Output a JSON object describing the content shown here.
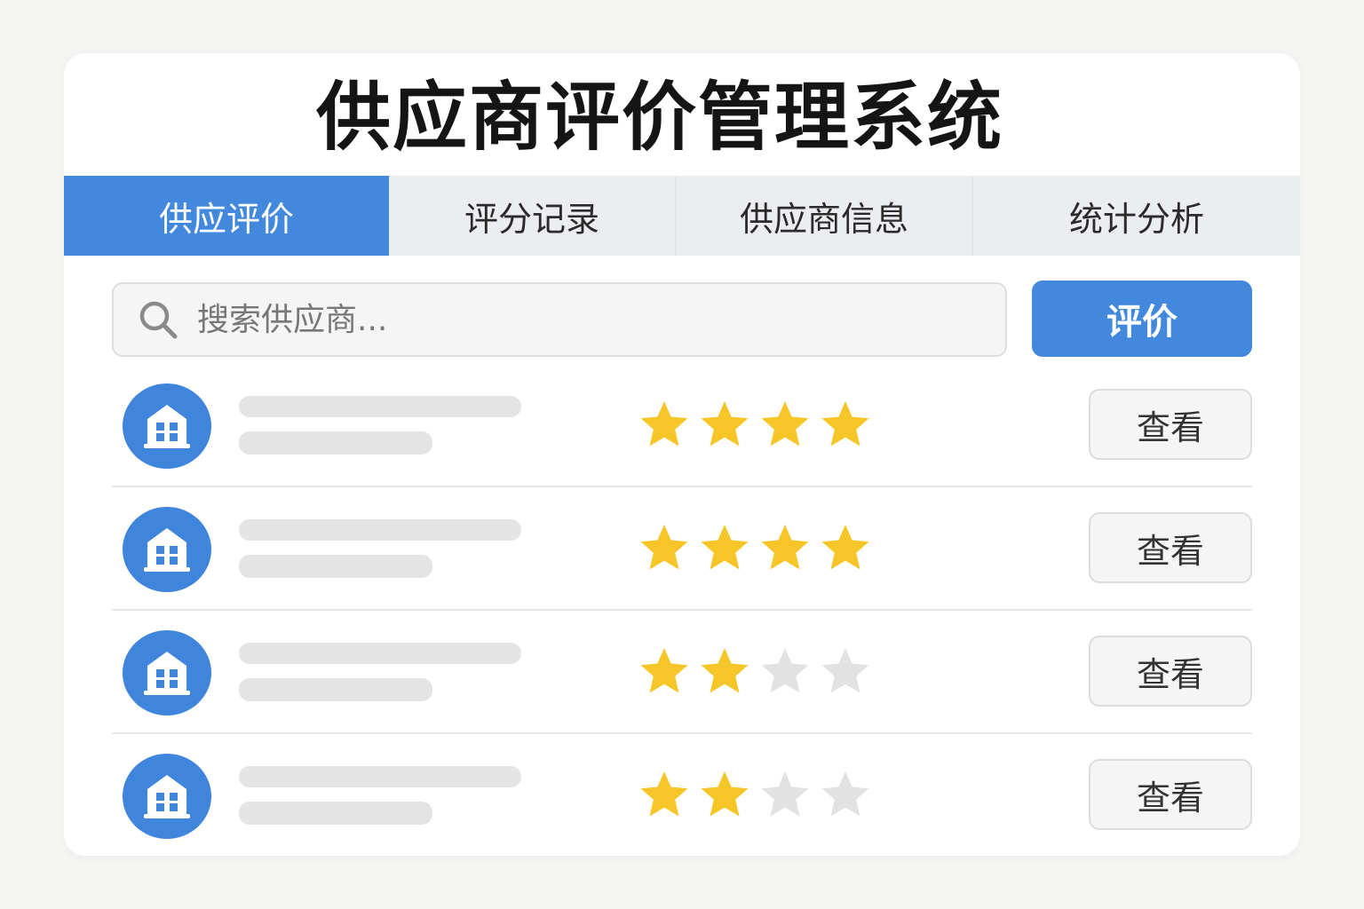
{
  "app": {
    "title": "供应商评价管理系统"
  },
  "tabs": [
    {
      "label": "供应评价",
      "active": true
    },
    {
      "label": "评分记录",
      "active": false
    },
    {
      "label": "供应商信息",
      "active": false
    },
    {
      "label": "统计分析",
      "active": false
    }
  ],
  "search": {
    "placeholder": "搜索供应商...",
    "value": "",
    "icon": "search-icon"
  },
  "toolbar": {
    "evaluate_label": "评价"
  },
  "suppliers": [
    {
      "icon": "building-icon",
      "rating": 4,
      "max_rating": 4,
      "view_label": "查看"
    },
    {
      "icon": "building-icon",
      "rating": 4,
      "max_rating": 4,
      "view_label": "查看"
    },
    {
      "icon": "building-icon",
      "rating": 2,
      "max_rating": 4,
      "view_label": "查看"
    },
    {
      "icon": "building-icon",
      "rating": 2,
      "max_rating": 4,
      "view_label": "查看"
    }
  ],
  "colors": {
    "accent": "#4288dd",
    "star_filled": "#f6c527",
    "star_empty": "#e2e2e2",
    "skeleton": "#e4e4e4"
  }
}
